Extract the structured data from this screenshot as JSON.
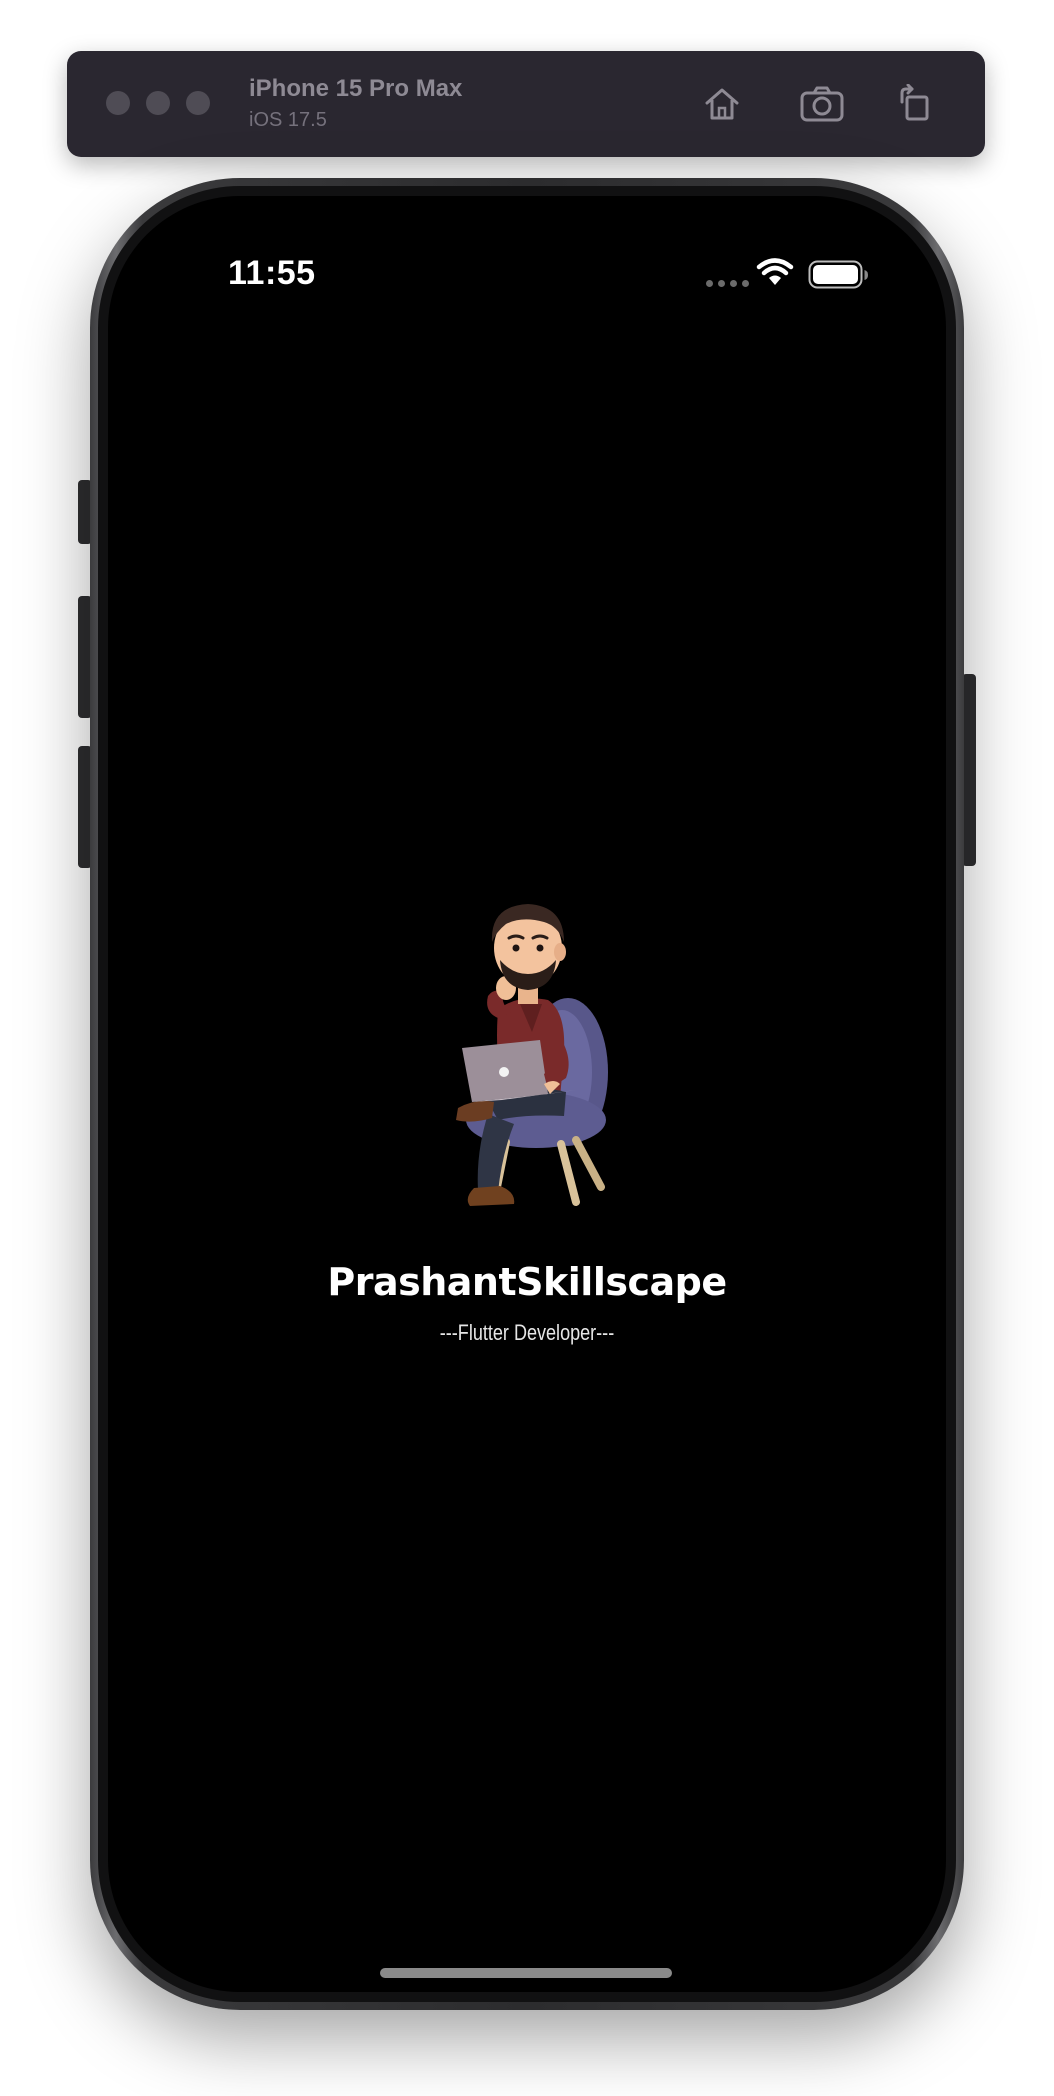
{
  "simulator": {
    "device_name": "iPhone 15 Pro Max",
    "os_version": "iOS 17.5",
    "buttons": {
      "home_icon": "house-icon",
      "screenshot_icon": "camera-icon",
      "rotate_icon": "rotate-icon"
    }
  },
  "status_bar": {
    "time": "11:55",
    "icons": [
      "cellular-signal-icon",
      "wifi-icon",
      "battery-icon"
    ]
  },
  "splash": {
    "avatar_icon": "developer-avatar-illustration",
    "app_name": "PrashantSkillscape",
    "tagline": "---Flutter Developer---"
  },
  "colors": {
    "screen_background": "#000000",
    "toolbar_background": "#2a2730",
    "text_primary": "#ffffff"
  }
}
